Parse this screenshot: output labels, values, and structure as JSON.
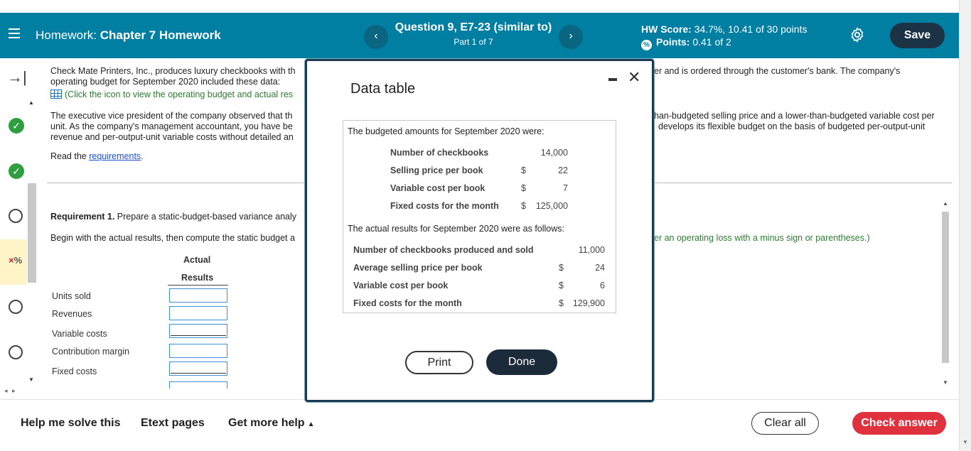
{
  "header": {
    "title_prefix": "Homework:",
    "title_name": "Chapter 7 Homework",
    "question_title": "Question 9, E7-23 (similar to)",
    "question_part": "Part 1 of 7",
    "prev_icon": "‹",
    "next_icon": "›",
    "hw_score_label": "HW Score:",
    "hw_score_value": "34.7%, 10.41 of 30 points",
    "points_label": "Points:",
    "points_value": "0.41 of 2",
    "save_label": "Save"
  },
  "rail": {
    "expand_icon": "→|",
    "progress_icon": "%"
  },
  "problem": {
    "intro_left": "Check Mate Printers, Inc., produces luxury checkbooks with th",
    "intro_left_2": "operating budget for September 2020 included these data:",
    "intro_right": "er and is ordered through the customer's bank. The company's",
    "icon_link": "(Click the icon to view the operating budget and actual res",
    "para2_left_1": "The executive vice president of the company observed that th",
    "para2_left_2": "unit. As the company's management accountant, you have be",
    "para2_left_3": "revenue and per-output-unit variable costs without detailed an",
    "para2_right_1": "han-budgeted selling price and a lower-than-budgeted variable cost per",
    "para2_right_2": "develops its flexible budget on the basis of budgeted per-output-unit",
    "read_prefix": "Read the",
    "read_link": "requirements",
    "read_suffix": ".",
    "req_bold": "Requirement 1.",
    "req_text": "Prepare a static-budget-based variance analy",
    "begin_text": "Begin with the actual results, then compute the static budget a",
    "loss_hint": "er an operating loss with a minus sign or parentheses.)",
    "col_h1": "Actual",
    "col_h2": "Results",
    "rows": [
      "Units sold",
      "Revenues",
      "Variable costs",
      "Contribution margin",
      "Fixed costs"
    ]
  },
  "modal": {
    "title": "Data table",
    "budget_heading": "The budgeted amounts for September 2020 were:",
    "budget_rows": [
      {
        "label": "Number of checkbooks",
        "dollar": "",
        "value": "14,000"
      },
      {
        "label": "Selling price per book",
        "dollar": "$",
        "value": "22"
      },
      {
        "label": "Variable cost per book",
        "dollar": "$",
        "value": "7"
      },
      {
        "label": "Fixed costs for the month",
        "dollar": "$",
        "value": "125,000"
      }
    ],
    "actual_heading": "The actual results for September 2020 were as follows:",
    "actual_rows": [
      {
        "label": "Number of checkbooks produced and sold",
        "dollar": "",
        "value": "11,000"
      },
      {
        "label": "Average selling price per book",
        "dollar": "$",
        "value": "24"
      },
      {
        "label": "Variable cost per book",
        "dollar": "$",
        "value": "6"
      },
      {
        "label": "Fixed costs for the month",
        "dollar": "$",
        "value": "129,900"
      }
    ],
    "print_label": "Print",
    "done_label": "Done"
  },
  "footer": {
    "help_label": "Help me solve this",
    "etext_label": "Etext pages",
    "more_help_label": "Get more help",
    "clear_label": "Clear all",
    "check_label": "Check answer"
  },
  "colors": {
    "header_bg": "#007fa3",
    "save_bg": "#1c3245",
    "check_bg": "#e0313f",
    "done_bg": "#1c2b3a",
    "correct_green": "#2e9e3f"
  }
}
